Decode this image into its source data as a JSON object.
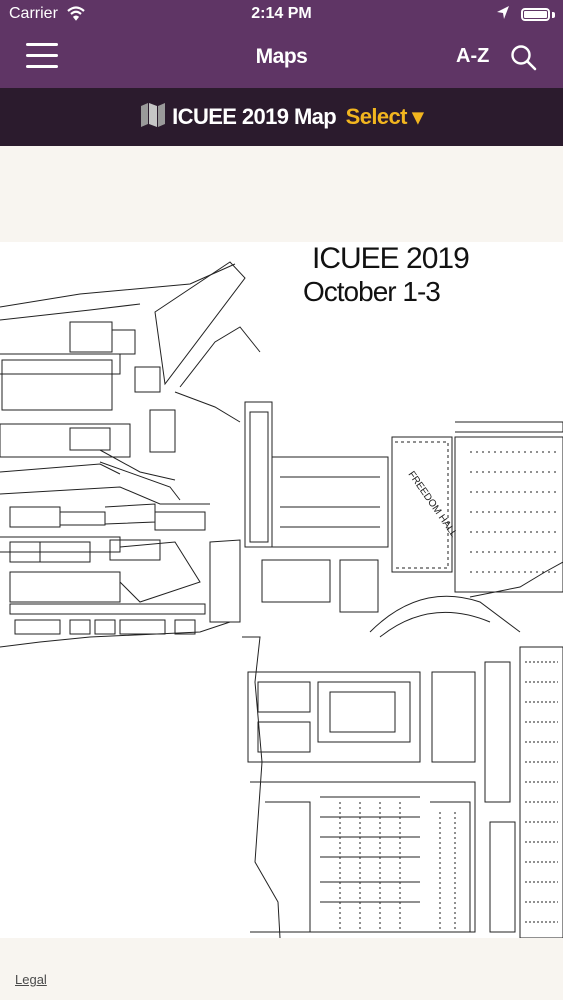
{
  "status_bar": {
    "carrier": "Carrier",
    "time": "2:14 PM"
  },
  "nav": {
    "title": "Maps",
    "az_label": "A-Z"
  },
  "sub_header": {
    "map_name": "ICUEE 2019 Map",
    "select_label": "Select ▾"
  },
  "map": {
    "title": "ICUEE 2019",
    "dates": "October 1-3",
    "hall_label": "FREEDOM HALL"
  },
  "footer": {
    "legal_link": "Legal"
  },
  "colors": {
    "nav_background": "#5f3565",
    "sub_header_background": "#2b1b2d",
    "select_accent": "#f2b51f",
    "page_background": "#f8f5f0"
  },
  "icons": [
    "wifi-icon",
    "location-arrow-icon",
    "battery-icon",
    "hamburger-menu-icon",
    "search-icon",
    "folded-map-icon"
  ]
}
